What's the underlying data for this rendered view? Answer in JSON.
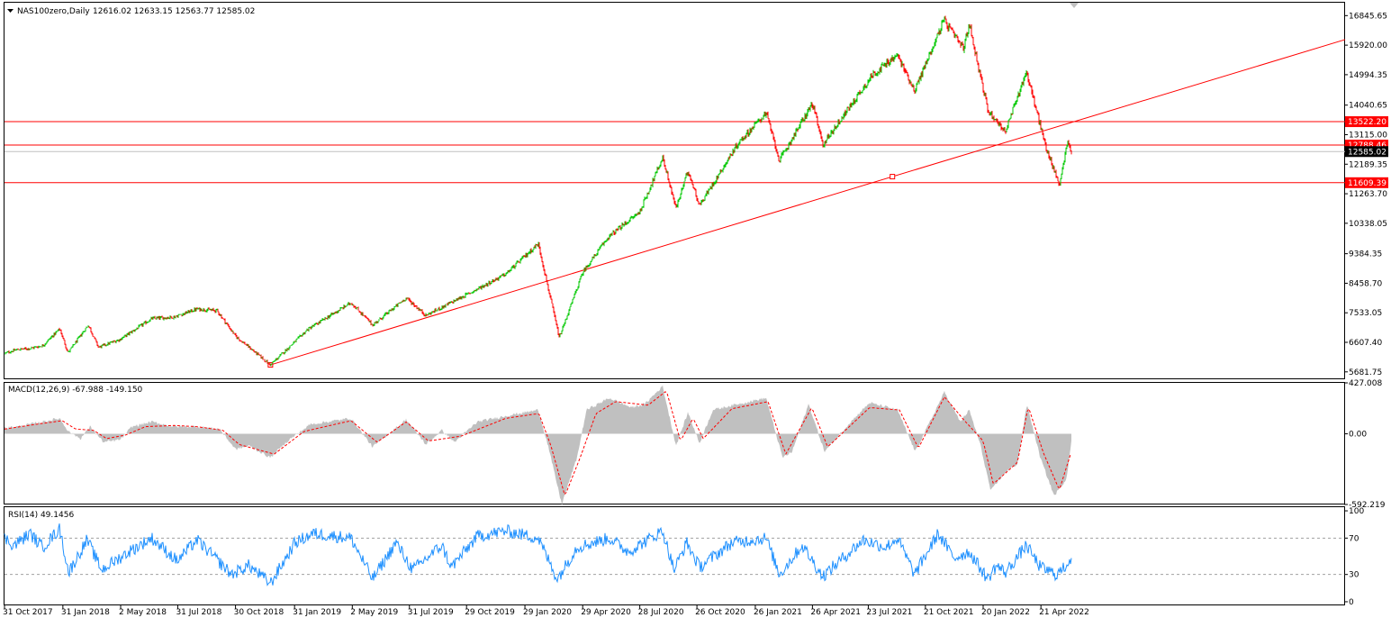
{
  "chart_data": [
    {
      "type": "candlestick",
      "title": "NAS100zero,Daily",
      "ohlc_label": "12616.02 12633.15 12563.77 12585.02",
      "ylim": [
        5450,
        17250
      ],
      "y_ticks": [
        {
          "value": 16845.65,
          "label": "16845.65"
        },
        {
          "value": 15920.0,
          "label": "15920.00"
        },
        {
          "value": 14994.35,
          "label": "14994.35"
        },
        {
          "value": 14040.65,
          "label": "14040.65"
        },
        {
          "value": 13115.0,
          "label": "13115.00"
        },
        {
          "value": 12189.35,
          "label": "12189.35"
        },
        {
          "value": 11263.7,
          "label": "11263.70"
        },
        {
          "value": 10338.05,
          "label": "10338.05"
        },
        {
          "value": 9384.35,
          "label": "9384.35"
        },
        {
          "value": 8458.7,
          "label": "8458.70"
        },
        {
          "value": 7533.05,
          "label": "7533.05"
        },
        {
          "value": 6607.4,
          "label": "6607.40"
        },
        {
          "value": 5681.75,
          "label": "5681.75"
        }
      ],
      "price_tags": [
        {
          "value": 13522.2,
          "label": "13522.20",
          "color": "#ff0000"
        },
        {
          "value": 12788.46,
          "label": "12788.46",
          "color": "#ff0000"
        },
        {
          "value": 12585.02,
          "label": "12585.02",
          "color": "#000000"
        },
        {
          "value": 11609.39,
          "label": "11609.39",
          "color": "#ff0000"
        }
      ],
      "horizontal_lines": [
        13522.2,
        12788.46,
        11609.39
      ],
      "current_price": 12585.02,
      "trendline": {
        "points": [
          {
            "date": "2018-12-24",
            "value": 5900
          },
          {
            "date": "2021-08-30",
            "value": 11800
          }
        ],
        "extends": "right",
        "color": "#ff0000"
      },
      "series_path": [
        [
          "2017-10-31",
          6260
        ],
        [
          "2017-11-20",
          6380
        ],
        [
          "2017-12-10",
          6420
        ],
        [
          "2017-12-30",
          6500
        ],
        [
          "2018-01-26",
          7030
        ],
        [
          "2018-02-08",
          6280
        ],
        [
          "2018-03-12",
          7150
        ],
        [
          "2018-03-28",
          6450
        ],
        [
          "2018-05-01",
          6700
        ],
        [
          "2018-06-20",
          7350
        ],
        [
          "2018-07-25",
          7400
        ],
        [
          "2018-08-30",
          7650
        ],
        [
          "2018-10-01",
          7600
        ],
        [
          "2018-10-30",
          6800
        ],
        [
          "2018-12-24",
          5900
        ],
        [
          "2019-02-20",
          7000
        ],
        [
          "2019-04-30",
          7850
        ],
        [
          "2019-06-03",
          7150
        ],
        [
          "2019-07-26",
          8000
        ],
        [
          "2019-08-26",
          7450
        ],
        [
          "2019-10-29",
          8100
        ],
        [
          "2019-12-30",
          8750
        ],
        [
          "2020-02-19",
          9700
        ],
        [
          "2020-03-23",
          6750
        ],
        [
          "2020-04-29",
          8800
        ],
        [
          "2020-06-08",
          9900
        ],
        [
          "2020-07-28",
          10700
        ],
        [
          "2020-09-02",
          12400
        ],
        [
          "2020-09-23",
          10800
        ],
        [
          "2020-10-12",
          12000
        ],
        [
          "2020-10-30",
          10900
        ],
        [
          "2020-12-30",
          12850
        ],
        [
          "2021-02-12",
          13800
        ],
        [
          "2021-03-05",
          12300
        ],
        [
          "2021-04-26",
          14100
        ],
        [
          "2021-05-12",
          12800
        ],
        [
          "2021-07-30",
          15000
        ],
        [
          "2021-09-07",
          15600
        ],
        [
          "2021-10-04",
          14500
        ],
        [
          "2021-11-19",
          16700
        ],
        [
          "2021-12-20",
          15800
        ],
        [
          "2021-12-29",
          16600
        ],
        [
          "2022-01-27",
          13900
        ],
        [
          "2022-02-24",
          13200
        ],
        [
          "2022-03-29",
          15100
        ],
        [
          "2022-04-29",
          12700
        ],
        [
          "2022-05-20",
          11550
        ],
        [
          "2022-06-02",
          12900
        ],
        [
          "2022-06-08",
          12600
        ]
      ]
    },
    {
      "type": "area",
      "title": "MACD(12,26,9) -67.988 -149.150",
      "indicator": "MACD(12,26,9)",
      "values_label": "-67.988 -149.150",
      "ylim": [
        -592.219,
        427.008
      ],
      "y_ticks": [
        {
          "value": 427.008,
          "label": "427.008"
        },
        {
          "value": 0,
          "label": "0.00"
        },
        {
          "value": -592.219,
          "label": "-592.219"
        }
      ],
      "macd_values": [
        [
          "2017-10-31",
          50
        ],
        [
          "2017-11-20",
          60
        ],
        [
          "2017-12-20",
          90
        ],
        [
          "2018-01-26",
          130
        ],
        [
          "2018-02-09",
          20
        ],
        [
          "2018-02-28",
          -40
        ],
        [
          "2018-03-15",
          60
        ],
        [
          "2018-04-05",
          -70
        ],
        [
          "2018-05-01",
          -50
        ],
        [
          "2018-05-20",
          60
        ],
        [
          "2018-06-20",
          100
        ],
        [
          "2018-07-25",
          60
        ],
        [
          "2018-08-30",
          60
        ],
        [
          "2018-10-05",
          40
        ],
        [
          "2018-10-30",
          -130
        ],
        [
          "2018-11-20",
          -100
        ],
        [
          "2018-12-24",
          -200
        ],
        [
          "2019-01-20",
          -60
        ],
        [
          "2019-02-25",
          80
        ],
        [
          "2019-04-30",
          130
        ],
        [
          "2019-06-03",
          -110
        ],
        [
          "2019-07-26",
          120
        ],
        [
          "2019-08-26",
          -90
        ],
        [
          "2019-09-20",
          30
        ],
        [
          "2019-10-10",
          -70
        ],
        [
          "2019-11-15",
          100
        ],
        [
          "2019-12-30",
          150
        ],
        [
          "2020-02-19",
          200
        ],
        [
          "2020-03-05",
          -90
        ],
        [
          "2020-03-27",
          -590
        ],
        [
          "2020-04-20",
          -200
        ],
        [
          "2020-05-05",
          200
        ],
        [
          "2020-06-10",
          300
        ],
        [
          "2020-07-15",
          220
        ],
        [
          "2020-08-05",
          250
        ],
        [
          "2020-09-02",
          400
        ],
        [
          "2020-09-23",
          -100
        ],
        [
          "2020-10-12",
          180
        ],
        [
          "2020-10-30",
          -80
        ],
        [
          "2020-11-20",
          200
        ],
        [
          "2020-12-30",
          250
        ],
        [
          "2021-02-12",
          300
        ],
        [
          "2021-03-10",
          -200
        ],
        [
          "2021-03-25",
          -150
        ],
        [
          "2021-04-20",
          250
        ],
        [
          "2021-05-15",
          -150
        ],
        [
          "2021-06-25",
          100
        ],
        [
          "2021-07-25",
          260
        ],
        [
          "2021-09-07",
          200
        ],
        [
          "2021-10-05",
          -150
        ],
        [
          "2021-11-20",
          350
        ],
        [
          "2021-12-15",
          100
        ],
        [
          "2021-12-29",
          200
        ],
        [
          "2022-01-15",
          -80
        ],
        [
          "2022-02-01",
          -480
        ],
        [
          "2022-02-24",
          -320
        ],
        [
          "2022-03-15",
          -250
        ],
        [
          "2022-03-30",
          250
        ],
        [
          "2022-04-20",
          -200
        ],
        [
          "2022-05-12",
          -520
        ],
        [
          "2022-05-31",
          -380
        ],
        [
          "2022-06-08",
          -68
        ]
      ],
      "signal_values": [
        [
          "2017-10-31",
          40
        ],
        [
          "2017-12-20",
          80
        ],
        [
          "2018-01-30",
          110
        ],
        [
          "2018-02-20",
          40
        ],
        [
          "2018-03-20",
          30
        ],
        [
          "2018-04-10",
          -40
        ],
        [
          "2018-05-10",
          -10
        ],
        [
          "2018-06-10",
          60
        ],
        [
          "2018-07-25",
          70
        ],
        [
          "2018-08-30",
          60
        ],
        [
          "2018-10-10",
          30
        ],
        [
          "2018-11-05",
          -90
        ],
        [
          "2018-12-30",
          -170
        ],
        [
          "2019-02-15",
          20
        ],
        [
          "2019-04-30",
          110
        ],
        [
          "2019-06-10",
          -70
        ],
        [
          "2019-07-26",
          100
        ],
        [
          "2019-08-30",
          -60
        ],
        [
          "2019-10-20",
          -20
        ],
        [
          "2019-12-30",
          130
        ],
        [
          "2020-02-20",
          170
        ],
        [
          "2020-03-10",
          -100
        ],
        [
          "2020-04-01",
          -520
        ],
        [
          "2020-04-25",
          -200
        ],
        [
          "2020-05-20",
          170
        ],
        [
          "2020-06-20",
          270
        ],
        [
          "2020-08-10",
          240
        ],
        [
          "2020-09-08",
          360
        ],
        [
          "2020-09-30",
          -60
        ],
        [
          "2020-10-20",
          130
        ],
        [
          "2020-11-05",
          -40
        ],
        [
          "2020-12-20",
          210
        ],
        [
          "2021-02-15",
          270
        ],
        [
          "2021-03-15",
          -170
        ],
        [
          "2021-04-25",
          220
        ],
        [
          "2021-05-20",
          -110
        ],
        [
          "2021-07-25",
          220
        ],
        [
          "2021-09-10",
          200
        ],
        [
          "2021-10-10",
          -120
        ],
        [
          "2021-11-20",
          310
        ],
        [
          "2021-12-20",
          120
        ],
        [
          "2022-01-20",
          -60
        ],
        [
          "2022-02-05",
          -420
        ],
        [
          "2022-03-15",
          -240
        ],
        [
          "2022-04-01",
          230
        ],
        [
          "2022-04-25",
          -160
        ],
        [
          "2022-05-20",
          -470
        ],
        [
          "2022-06-08",
          -149
        ]
      ]
    },
    {
      "type": "line",
      "title": "RSI(14) 49.1456",
      "indicator": "RSI(14)",
      "values_label": "49.1456",
      "ylim": [
        -4,
        104
      ],
      "y_ticks": [
        {
          "value": 100,
          "label": "100"
        },
        {
          "value": 70,
          "label": "70"
        },
        {
          "value": 30,
          "label": "30"
        },
        {
          "value": 0,
          "label": "0"
        }
      ],
      "levels": [
        70,
        30
      ],
      "values": [
        [
          "2017-10-31",
          70
        ],
        [
          "2017-11-15",
          62
        ],
        [
          "2017-12-10",
          75
        ],
        [
          "2017-12-30",
          60
        ],
        [
          "2018-01-26",
          80
        ],
        [
          "2018-02-09",
          32
        ],
        [
          "2018-03-10",
          68
        ],
        [
          "2018-04-02",
          35
        ],
        [
          "2018-05-15",
          55
        ],
        [
          "2018-06-20",
          70
        ],
        [
          "2018-07-30",
          45
        ],
        [
          "2018-08-30",
          68
        ],
        [
          "2018-10-24",
          30
        ],
        [
          "2018-11-20",
          40
        ],
        [
          "2018-12-24",
          20
        ],
        [
          "2019-02-01",
          65
        ],
        [
          "2019-03-01",
          75
        ],
        [
          "2019-04-30",
          70
        ],
        [
          "2019-06-03",
          25
        ],
        [
          "2019-07-10",
          65
        ],
        [
          "2019-08-05",
          35
        ],
        [
          "2019-09-20",
          62
        ],
        [
          "2019-10-05",
          38
        ],
        [
          "2019-11-15",
          72
        ],
        [
          "2019-12-30",
          78
        ],
        [
          "2020-02-19",
          70
        ],
        [
          "2020-03-20",
          25
        ],
        [
          "2020-04-20",
          60
        ],
        [
          "2020-06-10",
          70
        ],
        [
          "2020-07-10",
          55
        ],
        [
          "2020-09-02",
          78
        ],
        [
          "2020-09-20",
          35
        ],
        [
          "2020-10-10",
          65
        ],
        [
          "2020-10-30",
          38
        ],
        [
          "2020-12-20",
          65
        ],
        [
          "2021-02-12",
          70
        ],
        [
          "2021-03-05",
          30
        ],
        [
          "2021-04-10",
          62
        ],
        [
          "2021-05-12",
          28
        ],
        [
          "2021-07-15",
          68
        ],
        [
          "2021-08-20",
          60
        ],
        [
          "2021-09-07",
          70
        ],
        [
          "2021-10-04",
          30
        ],
        [
          "2021-11-10",
          75
        ],
        [
          "2021-12-05",
          48
        ],
        [
          "2021-12-29",
          55
        ],
        [
          "2022-01-27",
          25
        ],
        [
          "2022-02-10",
          40
        ],
        [
          "2022-02-24",
          32
        ],
        [
          "2022-03-29",
          62
        ],
        [
          "2022-04-20",
          38
        ],
        [
          "2022-05-15",
          30
        ],
        [
          "2022-05-25",
          35
        ],
        [
          "2022-06-08",
          49
        ]
      ]
    }
  ],
  "time_axis": {
    "start": "2017-10-31",
    "end": "2022-06-08",
    "labels": [
      {
        "date": "2017-10-31",
        "label": "31 Oct 2017"
      },
      {
        "date": "2018-01-31",
        "label": "31 Jan 2018"
      },
      {
        "date": "2018-05-02",
        "label": "2 May 2018"
      },
      {
        "date": "2018-07-31",
        "label": "31 Jul 2018"
      },
      {
        "date": "2018-10-30",
        "label": "30 Oct 2018"
      },
      {
        "date": "2019-01-31",
        "label": "31 Jan 2019"
      },
      {
        "date": "2019-05-02",
        "label": "2 May 2019"
      },
      {
        "date": "2019-07-31",
        "label": "31 Jul 2019"
      },
      {
        "date": "2019-10-29",
        "label": "29 Oct 2019"
      },
      {
        "date": "2020-01-29",
        "label": "29 Jan 2020"
      },
      {
        "date": "2020-04-29",
        "label": "29 Apr 2020"
      },
      {
        "date": "2020-07-28",
        "label": "28 Jul 2020"
      },
      {
        "date": "2020-10-26",
        "label": "26 Oct 2020"
      },
      {
        "date": "2021-01-26",
        "label": "26 Jan 2021"
      },
      {
        "date": "2021-04-26",
        "label": "26 Apr 2021"
      },
      {
        "date": "2021-07-23",
        "label": "23 Jul 2021"
      },
      {
        "date": "2021-10-21",
        "label": "21 Oct 2021"
      },
      {
        "date": "2022-01-20",
        "label": "20 Jan 2022"
      },
      {
        "date": "2022-04-21",
        "label": "21 Apr 2022"
      }
    ]
  },
  "colors": {
    "bull": "#00c800",
    "bear": "#ff0000",
    "line_color": "#ff0000",
    "macd_fill": "#c0c0c0",
    "signal": "#ff0000",
    "rsi": "#1e90ff",
    "axis_text": "#000000"
  },
  "ui": {
    "collapse_icon": "triangle-down-icon"
  }
}
